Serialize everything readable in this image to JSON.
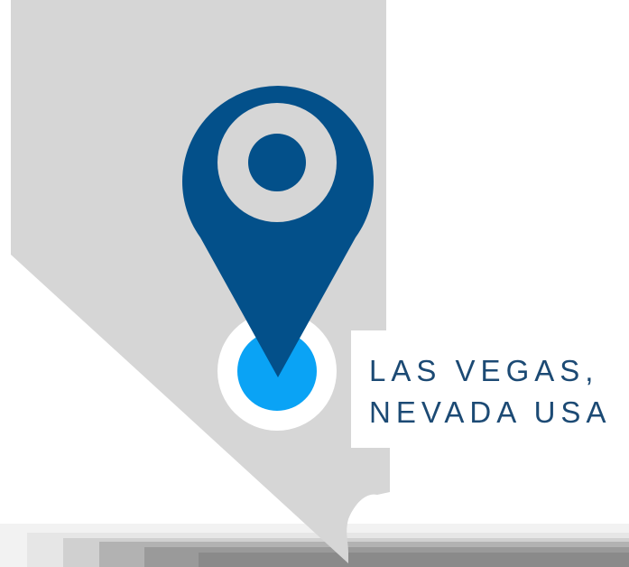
{
  "location": {
    "line1": "LAS VEGAS,",
    "line2": "NEVADA USA"
  },
  "icons": {
    "pin": "map-pin-icon",
    "marker": "location-dot-icon"
  },
  "colors": {
    "state_fill": "#d6d6d6",
    "pin_fill": "#03508a",
    "pin_ring": "#d6d6d6",
    "marker_fill": "#0aa3f5",
    "marker_halo": "#ffffff",
    "label_text": "#1c4a74",
    "shadow": "#8a8a8a"
  }
}
